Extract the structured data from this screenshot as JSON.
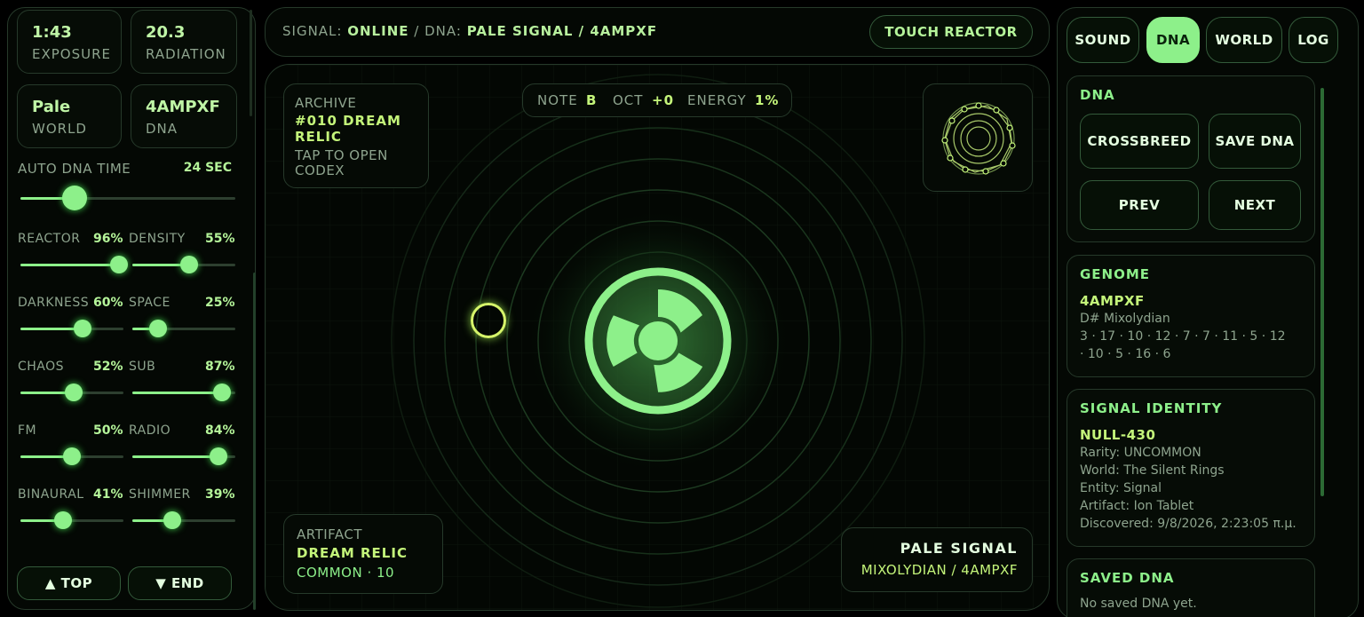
{
  "stats": [
    {
      "value": "1:43",
      "caption": "EXPOSURE"
    },
    {
      "value": "20.3",
      "caption": "RADIATION"
    },
    {
      "value": "Pale",
      "caption": "WORLD"
    },
    {
      "value": "4AMPXF",
      "caption": "DNA"
    }
  ],
  "auto_dna": {
    "label": "AUTO DNA TIME",
    "value": "24 SEC",
    "level": 0.25
  },
  "sliders": [
    {
      "label": "REACTOR",
      "value": "96%",
      "level": 0.96
    },
    {
      "label": "DENSITY",
      "value": "55%",
      "level": 0.55
    },
    {
      "label": "DARKNESS",
      "value": "60%",
      "level": 0.6
    },
    {
      "label": "SPACE",
      "value": "25%",
      "level": 0.25
    },
    {
      "label": "CHAOS",
      "value": "52%",
      "level": 0.52
    },
    {
      "label": "SUB",
      "value": "87%",
      "level": 0.87
    },
    {
      "label": "FM",
      "value": "50%",
      "level": 0.5
    },
    {
      "label": "RADIO",
      "value": "84%",
      "level": 0.84
    },
    {
      "label": "BINAURAL",
      "value": "41%",
      "level": 0.41
    },
    {
      "label": "SHIMMER",
      "value": "39%",
      "level": 0.39
    }
  ],
  "nav": {
    "top": "▲ TOP",
    "end": "▼ END"
  },
  "header": {
    "signal_label": "SIGNAL:",
    "signal_value": "ONLINE",
    "sep": "/",
    "dna_label": "DNA:",
    "dna_value": "PALE SIGNAL / 4AMPXF",
    "touch_button": "TOUCH REACTOR"
  },
  "archive": {
    "label": "ARCHIVE",
    "title": "#010 DREAM RELIC",
    "hint": "TAP TO OPEN CODEX"
  },
  "note_bar": {
    "note_label": "NOTE",
    "note": "B",
    "oct_label": "OCT",
    "oct": "+0",
    "energy_label": "ENERGY",
    "energy": "1%"
  },
  "artifact": {
    "label": "ARTIFACT",
    "name": "DREAM RELIC",
    "rarity": "COMMON · 10"
  },
  "signal_card": {
    "title": "PALE SIGNAL",
    "subtitle": "MIXOLYDIAN / 4AMPXF"
  },
  "tabs": [
    {
      "label": "SOUND",
      "active": false
    },
    {
      "label": "DNA",
      "active": true
    },
    {
      "label": "WORLD",
      "active": false
    },
    {
      "label": "LOG",
      "active": false
    }
  ],
  "dna_panel": {
    "title": "DNA",
    "crossbreed": "CROSSBREED",
    "save": "SAVE DNA",
    "prev": "PREV",
    "next": "NEXT"
  },
  "genome": {
    "title": "GENOME",
    "code": "4AMPXF",
    "scale": "D# Mixolydian",
    "sequence_1": "3 · 17 · 10 · 12 · 7 · 7 · 11 · 5 · 12",
    "sequence_2": "· 10 · 5 · 16 · 6"
  },
  "signal_identity": {
    "title": "SIGNAL IDENTITY",
    "id": "NULL-430",
    "rarity": "Rarity: UNCOMMON",
    "world": "World: The Silent Rings",
    "entity": "Entity: Signal",
    "artifact": "Artifact: Ion Tablet",
    "discovered": "Discovered: 9/8/2026, 2:23:05 π.μ."
  },
  "saved_dna": {
    "title": "SAVED DNA",
    "empty": "No saved DNA yet."
  },
  "colors": {
    "accent": "#8df08a",
    "accent_light": "#c4f57a",
    "border": "#26392a",
    "background": "#000000"
  },
  "icons": [
    "radiation-icon",
    "sigil-icon",
    "orbit-ring-icon"
  ]
}
